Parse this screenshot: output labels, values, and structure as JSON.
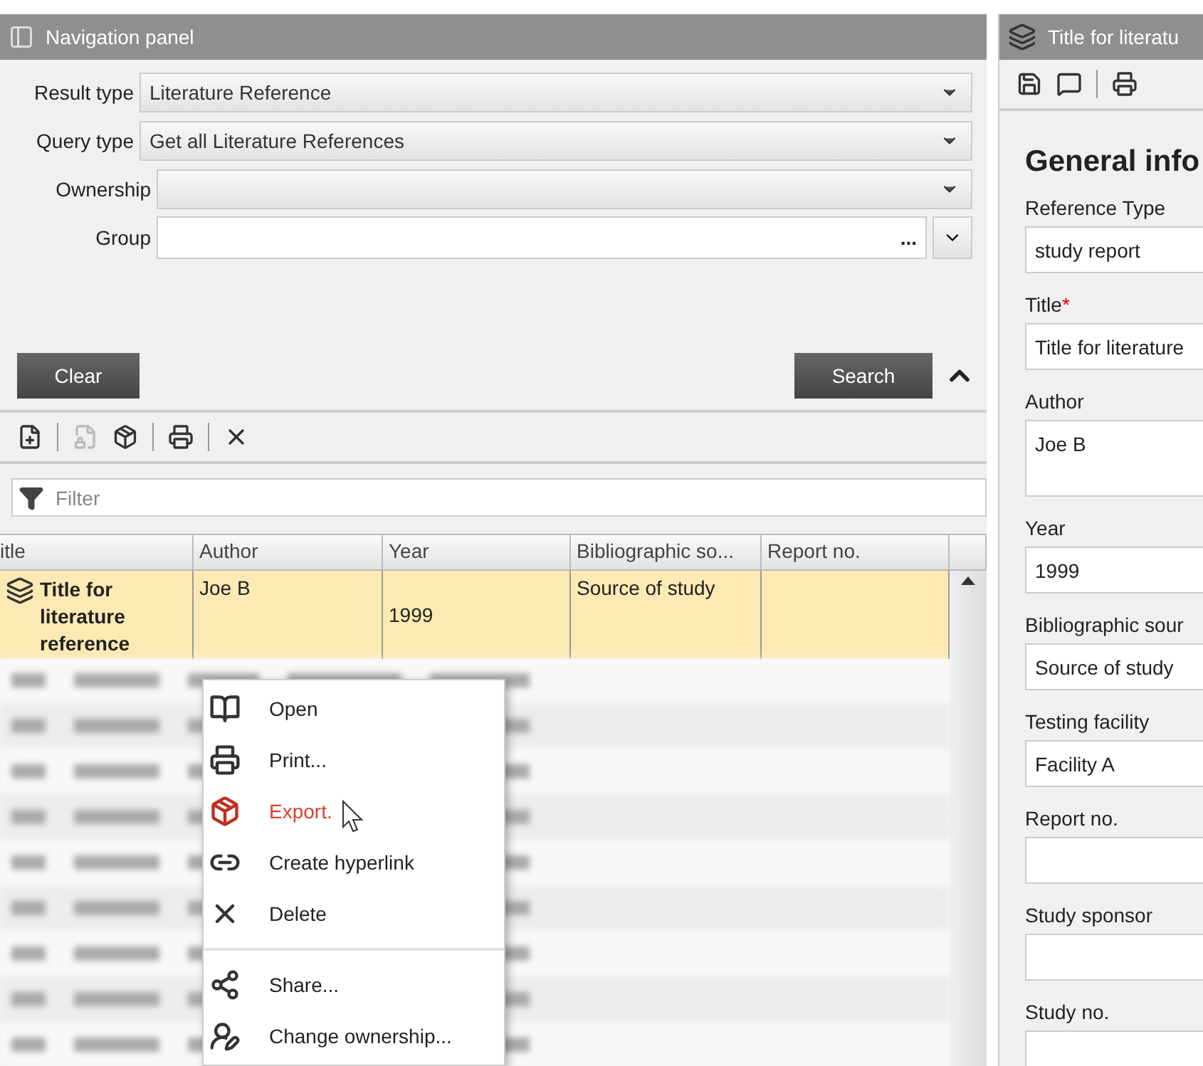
{
  "nav_panel": {
    "title": "Navigation panel",
    "fields": [
      {
        "kind": "select",
        "label": "Result type",
        "value": "Literature Reference"
      },
      {
        "kind": "select",
        "label": "Query type",
        "value": "Get all Literature References"
      },
      {
        "kind": "select",
        "label": "Ownership"
      },
      {
        "kind": "picker",
        "label": "Group",
        "button": "..."
      }
    ],
    "clear_button": "Clear",
    "search_button": "Search",
    "toolbar": [
      [
        {
          "disabled": false
        }
      ],
      [
        {
          "disabled": true
        },
        {
          "disabled": false
        }
      ],
      [
        {
          "disabled": false
        }
      ],
      [
        {
          "disabled": false
        }
      ]
    ],
    "filter": {
      "placeholder": "Filter"
    },
    "table": {
      "columns": [
        "itle",
        "Author",
        "Year",
        "Bibliographic so...",
        "Report no."
      ],
      "rows": [
        {
          "selected": true,
          "title": "Title for literature reference",
          "author": "Joe B",
          "year": "1999",
          "source": "Source of study"
        }
      ]
    },
    "context_menu": {
      "groups": [
        [
          {
            "label": "Open",
            "selected": false
          },
          {
            "label": "Print...",
            "selected": false
          },
          {
            "label": "Export.",
            "selected": true
          },
          {
            "label": "Create hyperlink",
            "selected": false
          },
          {
            "label": "Delete",
            "selected": false
          }
        ],
        [
          {
            "label": "Share...",
            "selected": false
          },
          {
            "label": "Change ownership...",
            "selected": false
          }
        ]
      ]
    }
  },
  "detail_panel": {
    "title": "Title for literatu",
    "toolbar": [
      [
        {
          "disabled": false
        },
        {
          "disabled": false
        }
      ],
      [
        {
          "disabled": false
        }
      ]
    ],
    "heading": "General info",
    "fields": [
      {
        "kind": "text",
        "label": "Reference Type",
        "value": "study report"
      },
      {
        "kind": "text",
        "label": "Title",
        "required_mark": "*",
        "value": "Title for literature"
      },
      {
        "kind": "multiline",
        "label": "Author",
        "value": "Joe B"
      },
      {
        "kind": "text",
        "label": "Year",
        "value": "1999"
      },
      {
        "kind": "text",
        "label": "Bibliographic sour",
        "value": "Source of study"
      },
      {
        "kind": "text",
        "label": "Testing facility",
        "value": "Facility A"
      },
      {
        "kind": "text",
        "label": "Report no."
      },
      {
        "kind": "text",
        "label": "Study sponsor"
      },
      {
        "kind": "text",
        "label": "Study no."
      }
    ]
  }
}
